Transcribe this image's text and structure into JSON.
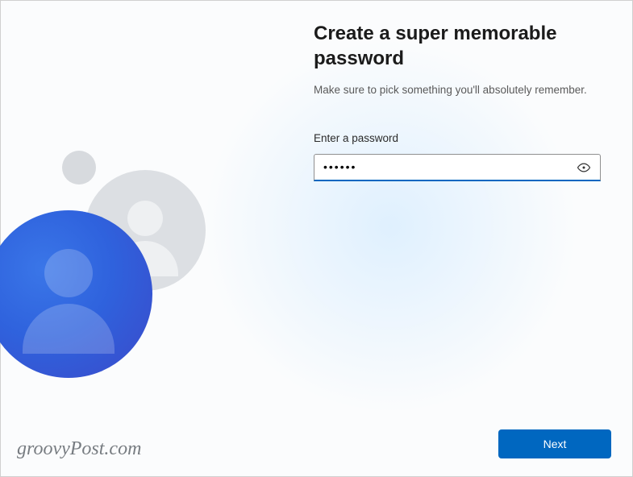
{
  "heading": "Create a super memorable password",
  "subtitle": "Make sure to pick something you'll absolutely remember.",
  "password": {
    "label": "Enter a password",
    "value": "••••••"
  },
  "buttons": {
    "next": "Next"
  },
  "watermark": "groovyPost.com"
}
